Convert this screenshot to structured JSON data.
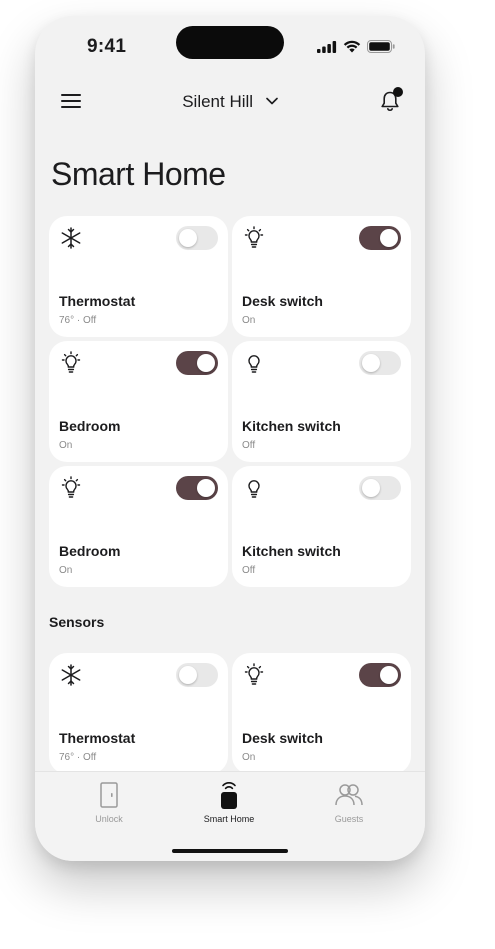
{
  "status_bar": {
    "time": "9:41"
  },
  "nav": {
    "location": "Silent Hill"
  },
  "page": {
    "title": "Smart Home"
  },
  "devices": [
    {
      "name": "Thermostat",
      "state": "76° · Off",
      "icon": "snowflake-icon",
      "on": false
    },
    {
      "name": "Desk switch",
      "state": "On",
      "icon": "bulb-glow-icon",
      "on": true
    },
    {
      "name": "Bedroom",
      "state": "On",
      "icon": "bulb-glow-icon",
      "on": true
    },
    {
      "name": "Kitchen switch",
      "state": "Off",
      "icon": "bulb-icon",
      "on": false
    },
    {
      "name": "Bedroom",
      "state": "On",
      "icon": "bulb-glow-icon",
      "on": true
    },
    {
      "name": "Kitchen switch",
      "state": "Off",
      "icon": "bulb-icon",
      "on": false
    }
  ],
  "sensors": {
    "title": "Sensors",
    "items": [
      {
        "name": "Thermostat",
        "state": "76° · Off",
        "icon": "snowflake-icon",
        "on": false
      },
      {
        "name": "Desk switch",
        "state": "On",
        "icon": "bulb-glow-icon",
        "on": true
      }
    ]
  },
  "tabbar": {
    "tabs": [
      {
        "label": "Unlock",
        "icon": "door-icon",
        "active": false
      },
      {
        "label": "Smart Home",
        "icon": "smart-speaker-icon",
        "active": true
      },
      {
        "label": "Guests",
        "icon": "users-icon",
        "active": false
      }
    ]
  },
  "colors": {
    "toggle_on": "#5b4448",
    "toggle_off": "#e8e8e8",
    "background": "#f2f2f2",
    "card": "#ffffff"
  }
}
